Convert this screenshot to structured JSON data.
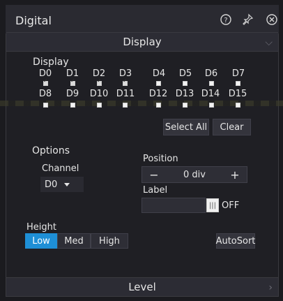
{
  "window": {
    "title": "Digital",
    "icons": [
      "help-icon",
      "pin-icon",
      "close-icon"
    ]
  },
  "display_section": {
    "header": "Display",
    "group_label": "Display",
    "channels_row1": [
      "D0",
      "D1",
      "D2",
      "D3",
      "D4",
      "D5",
      "D6",
      "D7"
    ],
    "channels_row2": [
      "D8",
      "D9",
      "D10",
      "D11",
      "D12",
      "D13",
      "D14",
      "D15"
    ],
    "checked_row1": [
      true,
      true,
      true,
      true,
      false,
      false,
      false,
      false
    ],
    "checked_row2": [
      false,
      false,
      false,
      false,
      false,
      false,
      false,
      false
    ],
    "select_all": "Select All",
    "clear": "Clear"
  },
  "options": {
    "label": "Options",
    "channel_label": "Channel",
    "channel_value": "D0",
    "position_label": "Position",
    "position_value": "0 div",
    "minus": "−",
    "plus": "+",
    "label_label": "Label",
    "label_value": "",
    "toggle_text": "OFF"
  },
  "height": {
    "label": "Height",
    "options": [
      "Low",
      "Med",
      "High"
    ],
    "selected": "Low"
  },
  "autosort": "AutoSort",
  "level_section": {
    "header": "Level"
  },
  "colors": {
    "accent": "#1e8fd6",
    "background": "#1f1f24",
    "header": "#2c2c34"
  }
}
